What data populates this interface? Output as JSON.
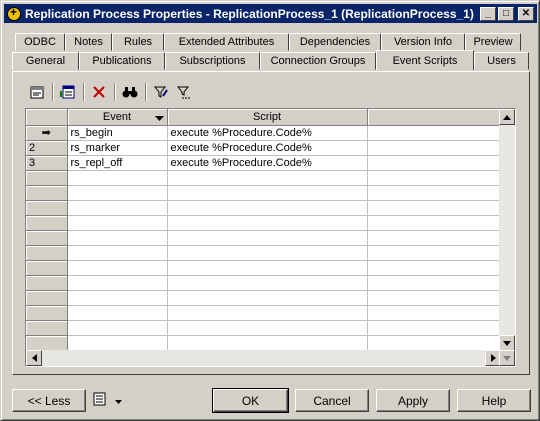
{
  "window": {
    "title": "Replication Process Properties - ReplicationProcess_1 (ReplicationProcess_1)"
  },
  "titlebar_buttons": [
    "_",
    "□",
    "✕"
  ],
  "tabs_back": [
    "ODBC",
    "Notes",
    "Rules",
    "Extended Attributes",
    "Dependencies",
    "Version Info",
    "Preview"
  ],
  "tabs_front": [
    "General",
    "Publications",
    "Subscriptions",
    "Connection Groups",
    "Event Scripts",
    "Users"
  ],
  "active_tab": "Event Scripts",
  "toolbar": {
    "icons": [
      "properties-icon",
      "add-rows-icon",
      "delete-icon",
      "find-icon",
      "filter-icon",
      "filter-clear-icon"
    ]
  },
  "grid": {
    "columns": [
      {
        "label": "Event",
        "has_dropdown": true
      },
      {
        "label": "Script"
      },
      {
        "label": ""
      }
    ],
    "rows": [
      {
        "rowheader": "➡",
        "event": "rs_begin",
        "script": "execute %Procedure.Code%"
      },
      {
        "rowheader": "2",
        "event": "rs_marker",
        "script": "execute %Procedure.Code%"
      },
      {
        "rowheader": "3",
        "event": "rs_repl_off",
        "script": "execute %Procedure.Code%"
      }
    ],
    "empty_rows": 12
  },
  "buttons": {
    "less": "<< Less",
    "ok": "OK",
    "cancel": "Cancel",
    "apply": "Apply",
    "help": "Help"
  },
  "colors": {
    "titlebar": "#0a246a",
    "face": "#d4d0c8"
  }
}
